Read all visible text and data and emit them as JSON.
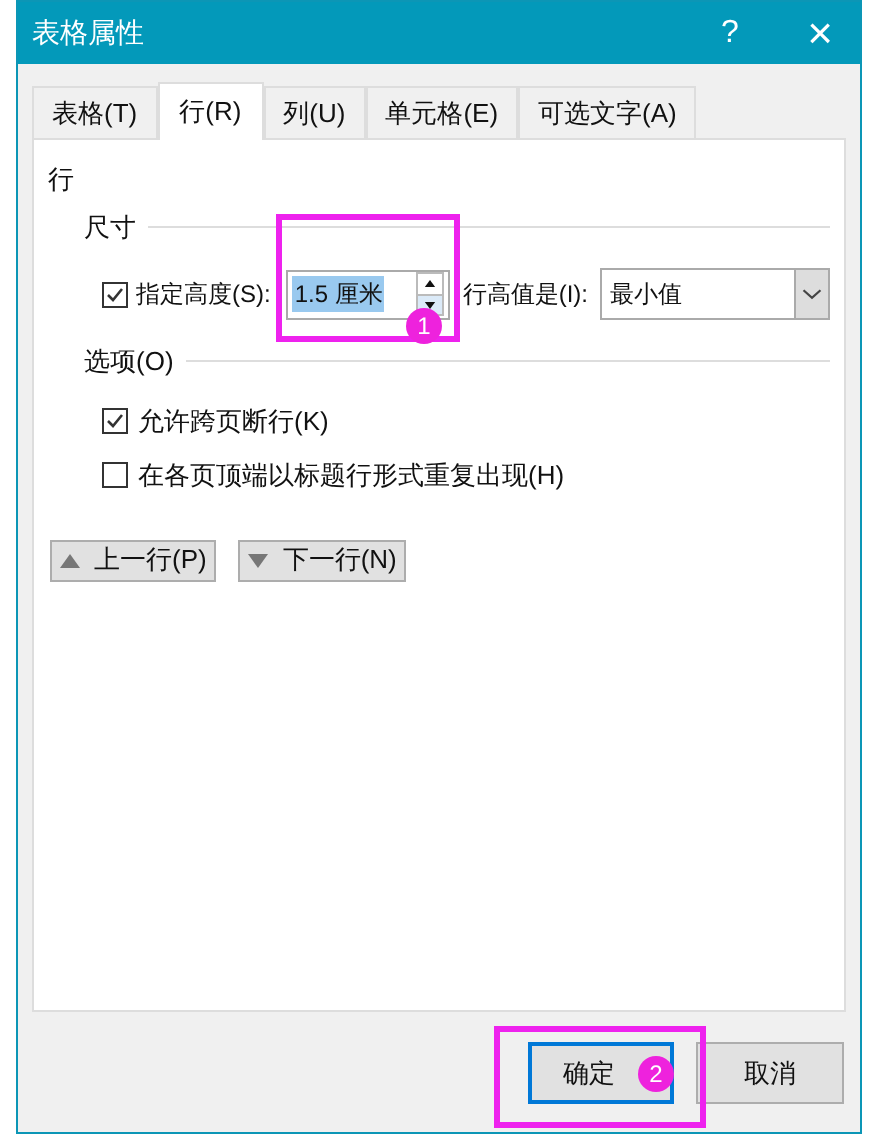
{
  "window": {
    "title": "表格属性",
    "help": "?",
    "close": "×"
  },
  "tabs": [
    {
      "label": "表格(T)",
      "selected": false
    },
    {
      "label": "行(R)",
      "selected": true
    },
    {
      "label": "列(U)",
      "selected": false
    },
    {
      "label": "单元格(E)",
      "selected": false
    },
    {
      "label": "可选文字(A)",
      "selected": false
    }
  ],
  "panel": {
    "heading": "行",
    "size_group": {
      "title": "尺寸",
      "specify_height": {
        "label": "指定高度(S):",
        "checked": true
      },
      "height_field": {
        "value": "1.5 厘米"
      },
      "height_mode": {
        "label": "行高值是(I):",
        "value": "最小值"
      }
    },
    "options_group": {
      "title": "选项(O)",
      "options": [
        {
          "label": "允许跨页断行(K)",
          "checked": true
        },
        {
          "label": "在各页顶端以标题行形式重复出现(H)",
          "checked": false
        }
      ]
    },
    "nav_buttons": [
      {
        "label": "上一行(P)",
        "kind": "up"
      },
      {
        "label": "下一行(N)",
        "kind": "down"
      }
    ]
  },
  "buttons": [
    {
      "label": "确定",
      "kind": "default"
    },
    {
      "label": "取消",
      "kind": "normal"
    }
  ],
  "annotations": [
    {
      "number": "1"
    },
    {
      "number": "2"
    }
  ]
}
